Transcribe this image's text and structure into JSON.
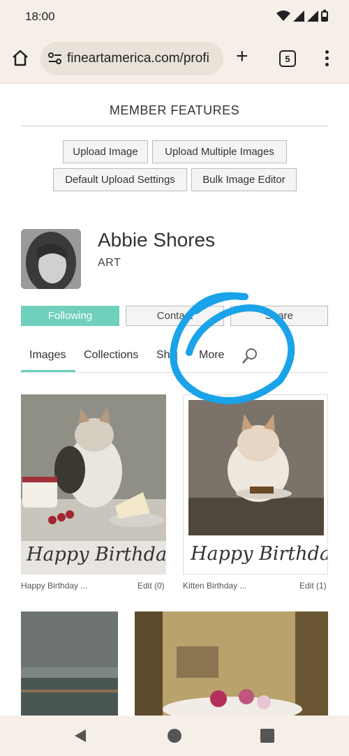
{
  "status_bar": {
    "time": "18:00"
  },
  "browser": {
    "url": "fineartamerica.com/profi",
    "tab_count": "5"
  },
  "member_features": {
    "title": "MEMBER FEATURES",
    "buttons": [
      "Upload Image",
      "Upload Multiple Images",
      "Default Upload Settings",
      "Bulk Image Editor"
    ]
  },
  "profile": {
    "name": "Abbie Shores",
    "subtitle": "ART",
    "actions": {
      "following": "Following",
      "contact": "Contact",
      "share": "Share"
    }
  },
  "tabs": [
    "Images",
    "Collections",
    "Shop",
    "More"
  ],
  "gallery": [
    {
      "title": "Happy Birthday ...",
      "edit": "Edit (0)",
      "overlay": "Happy Birthday"
    },
    {
      "title": "Kitten Birthday ...",
      "edit": "Edit (1)",
      "overlay": "Happy Birthday"
    }
  ],
  "annotation_color": "#1aa3e8",
  "accent_color": "#6fd0bd"
}
